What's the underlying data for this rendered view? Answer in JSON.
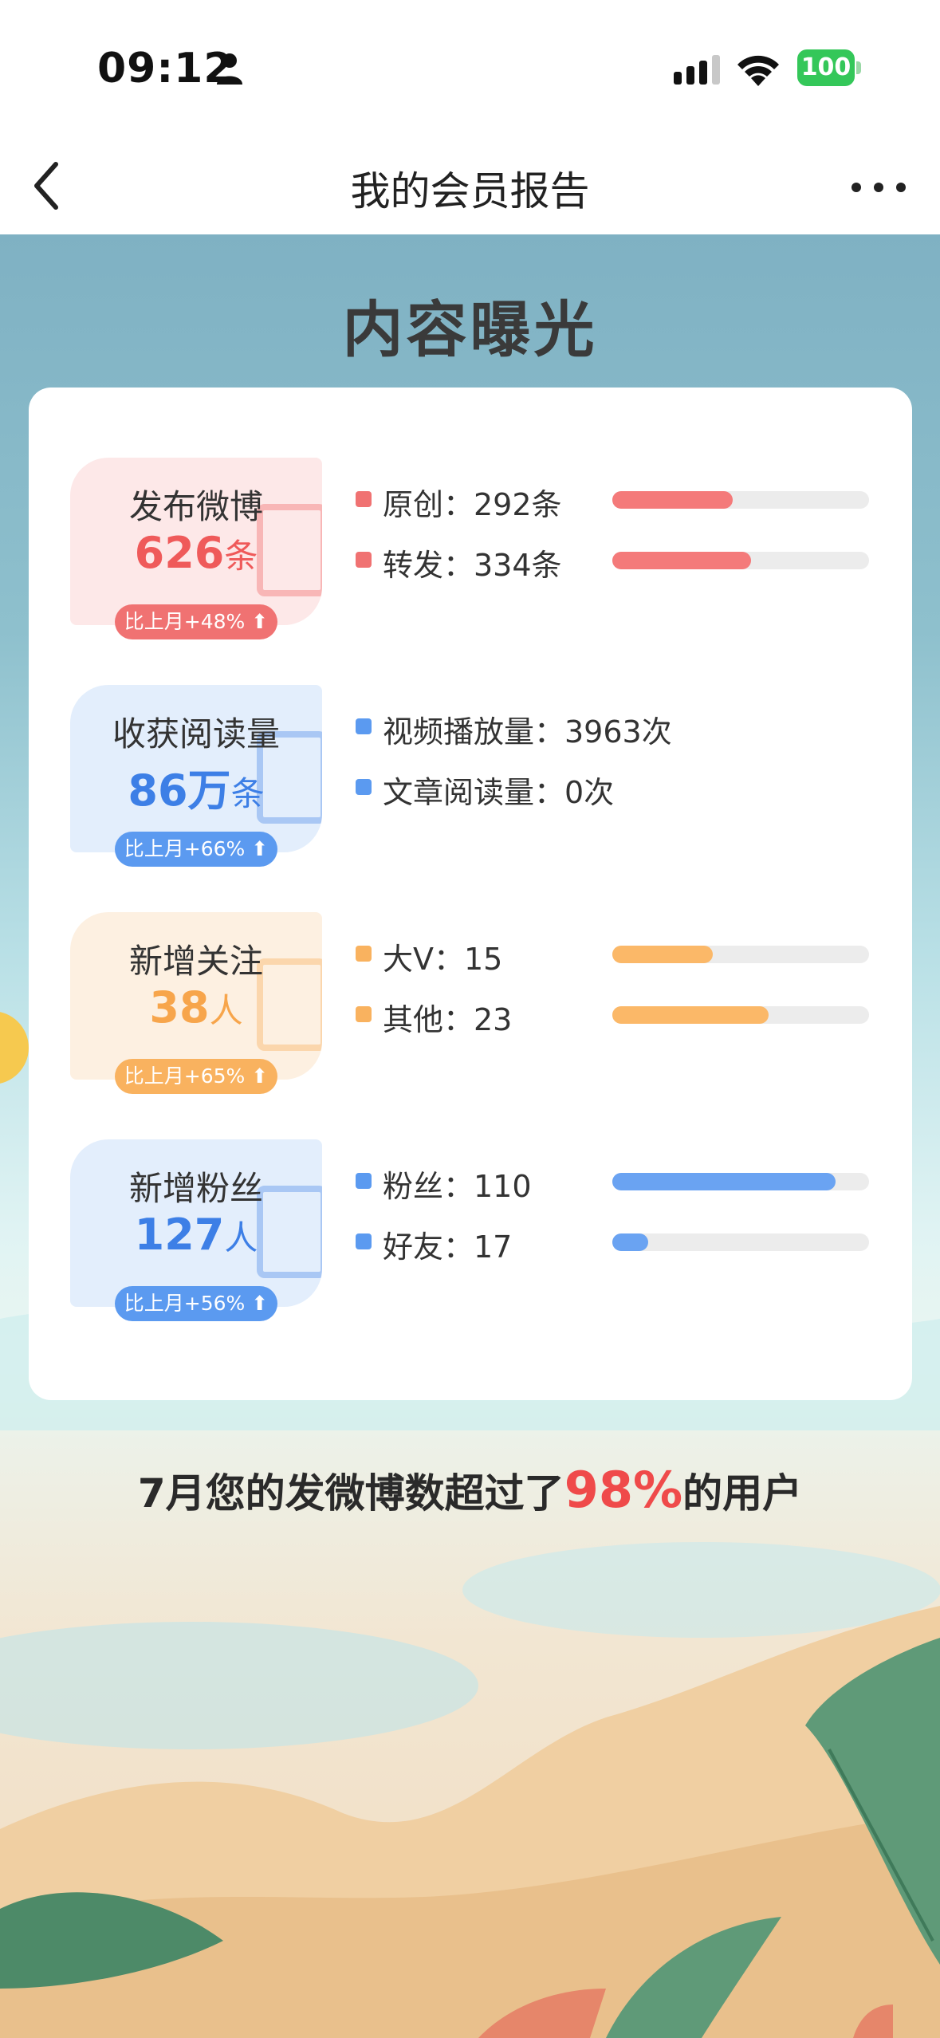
{
  "status_bar": {
    "time": "09:12",
    "battery": "100"
  },
  "nav": {
    "title": "我的会员报告"
  },
  "section": {
    "title": "内容曝光"
  },
  "stats": [
    {
      "label": "发布微博",
      "value": "626",
      "unit": "条",
      "badge": "比上月+48% ⬆",
      "color": "#ef5a5a",
      "pill_bg": "#fde8e8",
      "badge_bg": "#f07272",
      "items": [
        {
          "text": "原创：292条",
          "dot": "#f07272",
          "bar_fraction": 0.47,
          "bar_color": "#f47a7a"
        },
        {
          "text": "转发：334条",
          "dot": "#f07272",
          "bar_fraction": 0.54,
          "bar_color": "#f47a7a"
        }
      ]
    },
    {
      "label": "收获阅读量",
      "value": "86万",
      "unit": "条",
      "badge": "比上月+66% ⬆",
      "color": "#3d7fe6",
      "pill_bg": "#e3eefc",
      "badge_bg": "#5b9af0",
      "items": [
        {
          "text": "视频播放量：3963次",
          "dot": "#5b9af0"
        },
        {
          "text": "文章阅读量：0次",
          "dot": "#5b9af0"
        }
      ]
    },
    {
      "label": "新增关注",
      "value": "38",
      "unit": "人",
      "badge": "比上月+65% ⬆",
      "color": "#f7a54b",
      "pill_bg": "#fdf0e1",
      "badge_bg": "#f9b25f",
      "items": [
        {
          "text": "大V：15",
          "dot": "#f9b25f",
          "bar_fraction": 0.39,
          "bar_color": "#fbb868"
        },
        {
          "text": "其他：23",
          "dot": "#f9b25f",
          "bar_fraction": 0.61,
          "bar_color": "#fbb868"
        }
      ]
    },
    {
      "label": "新增粉丝",
      "value": "127",
      "unit": "人",
      "badge": "比上月+56% ⬆",
      "color": "#3d7fe6",
      "pill_bg": "#e3eefc",
      "badge_bg": "#5b9af0",
      "items": [
        {
          "text": "粉丝：110",
          "dot": "#5b9af0",
          "bar_fraction": 0.87,
          "bar_color": "#6aa3f2"
        },
        {
          "text": "好友：17",
          "dot": "#5b9af0",
          "bar_fraction": 0.14,
          "bar_color": "#6aa3f2"
        }
      ]
    }
  ],
  "highlight": {
    "prefix": "7月您的发微博数超过了",
    "percent": "98%",
    "suffix": "的用户"
  }
}
